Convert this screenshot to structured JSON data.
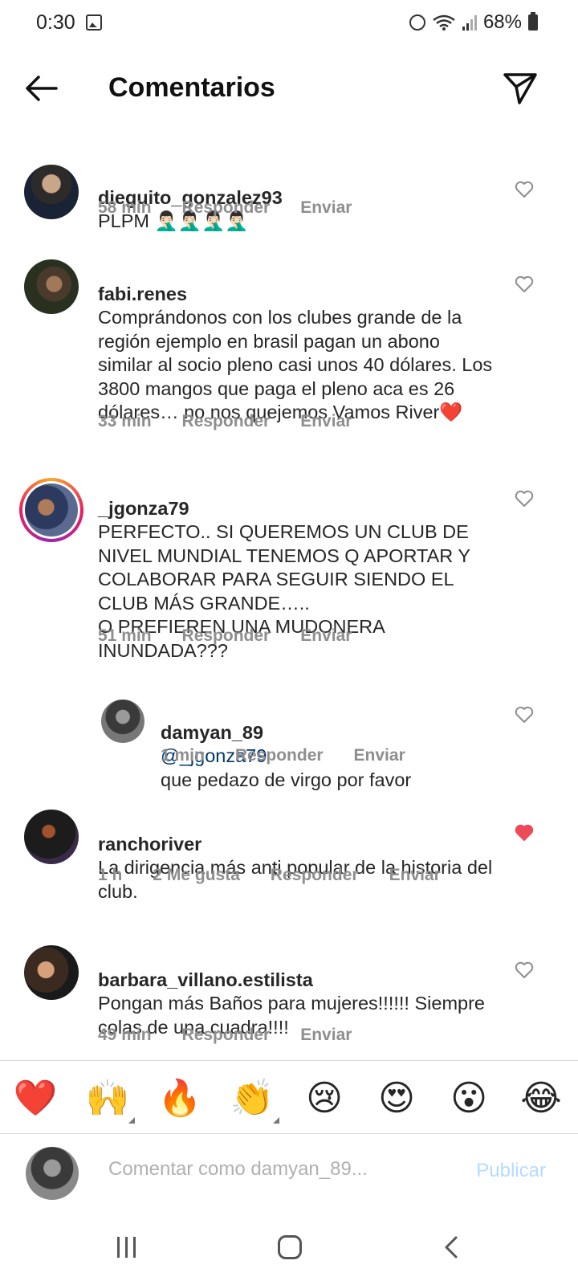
{
  "status": {
    "time": "0:30",
    "battery": "68%"
  },
  "header": {
    "title": "Comentarios",
    "back_icon": "arrow-left-icon",
    "share_icon": "paper-plane-icon"
  },
  "comments": [
    {
      "username": "dieguito_gonzalez93",
      "text": "PLPM 🤦🏻‍♂️🤦🏻‍♂️🤦🏻‍♂️🤦🏻‍♂️",
      "time": "58 min",
      "reply": "Responder",
      "send": "Enviar",
      "liked": false
    },
    {
      "username": "fabi.renes",
      "text": "Comprándonos con los clubes grande de la región ejemplo en brasil pagan un abono similar al socio pleno casi unos 40 dólares. Los 3800 mangos que paga el pleno aca es 26 dólares…  no nos quejemos Vamos River❤️",
      "time": "33 min",
      "reply": "Responder",
      "send": "Enviar",
      "liked": false
    },
    {
      "username": "_jgonza79",
      "text": "PERFECTO.. SI QUEREMOS UN CLUB DE NIVEL MUNDIAL TENEMOS Q APORTAR Y COLABORAR PARA SEGUIR SIENDO EL CLUB MÁS GRANDE….. \nO PREFIEREN UNA MUDONERA INUNDADA???",
      "time": "51 min",
      "reply": "Responder",
      "send": "Enviar",
      "liked": false
    },
    {
      "username": "damyan_89",
      "mention": "@_jgonza79",
      "text": "que pedazo de virgo por favor",
      "time": "1 min",
      "reply": "Responder",
      "send": "Enviar",
      "liked": false
    },
    {
      "username": "ranchoriver",
      "text": "La dirigencia más anti popular de la historia del club.",
      "time": "1 h",
      "likes": "2 Me gusta",
      "reply": "Responder",
      "send": "Enviar",
      "liked": true
    },
    {
      "username": "barbara_villano.estilista",
      "text": "Pongan más Baños para mujeres!!!!!! Siempre colas de una cuadra!!!!",
      "time": "49 min",
      "reply": "Responder",
      "send": "Enviar",
      "liked": false
    }
  ],
  "emoji_bar": [
    "❤️",
    "🙌",
    "🔥",
    "👏",
    "😢",
    "😍",
    "😮",
    "😂"
  ],
  "composer": {
    "placeholder": "Comentar como damyan_89...",
    "publish": "Publicar"
  },
  "colors": {
    "like_red": "#ed4956",
    "mention": "#00376b",
    "meta_gray": "#8e8e8e",
    "publish_disabled": "#b3dbff"
  }
}
